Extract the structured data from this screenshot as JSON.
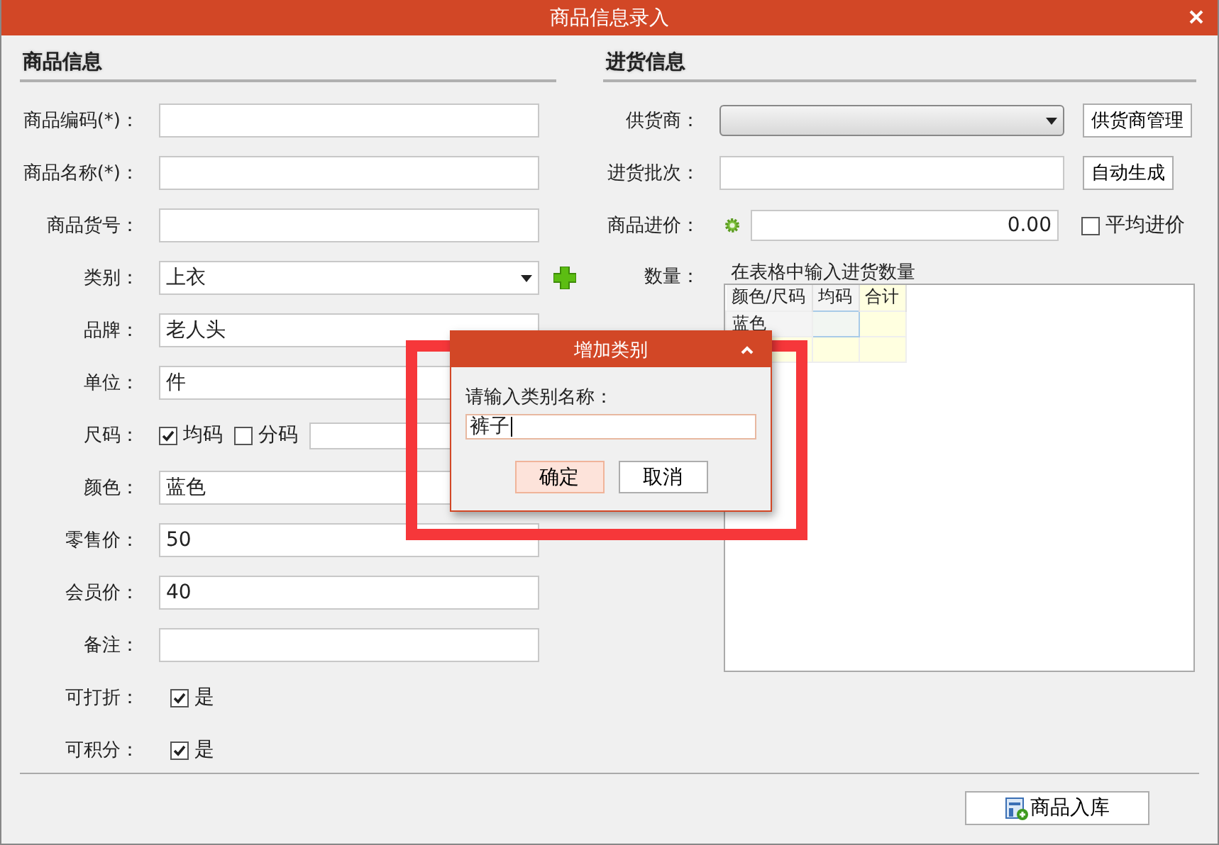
{
  "window": {
    "title": "商品信息录入"
  },
  "product_info": {
    "heading": "商品信息",
    "fields": [
      {
        "kind": "text",
        "label": "商品编码(*)："
      },
      {
        "kind": "text",
        "label": "商品名称(*)："
      },
      {
        "kind": "text",
        "label": "商品货号："
      },
      {
        "kind": "select",
        "label": "类别：",
        "value": "上衣"
      },
      {
        "kind": "text",
        "label": "品牌：",
        "value": "老人头"
      },
      {
        "kind": "text",
        "label": "单位：",
        "value": "件"
      },
      {
        "kind": "sizes",
        "label": "尺码：",
        "options": [
          {
            "label": "均码",
            "checked": true
          },
          {
            "label": "分码",
            "checked": false
          }
        ]
      },
      {
        "kind": "text",
        "label": "颜色：",
        "value": "蓝色"
      },
      {
        "kind": "text",
        "label": "零售价：",
        "value": "50"
      },
      {
        "kind": "text",
        "label": "会员价：",
        "value": "40"
      },
      {
        "kind": "text",
        "label": "备注："
      },
      {
        "kind": "checkbox",
        "label": "可打折：",
        "option": "是",
        "checked": true
      },
      {
        "kind": "checkbox",
        "label": "可积分：",
        "option": "是",
        "checked": true
      }
    ]
  },
  "purchase_info": {
    "heading": "进货信息",
    "fields": [
      {
        "kind": "select",
        "label": "供货商：",
        "button": "供货商管理"
      },
      {
        "kind": "text",
        "label": "进货批次：",
        "button": "自动生成"
      },
      {
        "kind": "price",
        "label": "商品进价：",
        "value": "0.00",
        "option": "平均进价",
        "checked": false
      },
      {
        "kind": "quantity",
        "label": "数量：",
        "legend": "在表格中输入进货数量",
        "columns": [
          "颜色/尺码",
          "均码",
          "合计"
        ],
        "rows": [
          {
            "color_name": "蓝色"
          }
        ]
      }
    ]
  },
  "footer": {
    "button": "商品入库"
  },
  "dialog": {
    "title": "增加类别",
    "prompt": "请输入类别名称：",
    "value": "裤子",
    "buttons": [
      {
        "label": "确定",
        "selected": true
      },
      {
        "label": "取消",
        "selected": false
      }
    ]
  }
}
